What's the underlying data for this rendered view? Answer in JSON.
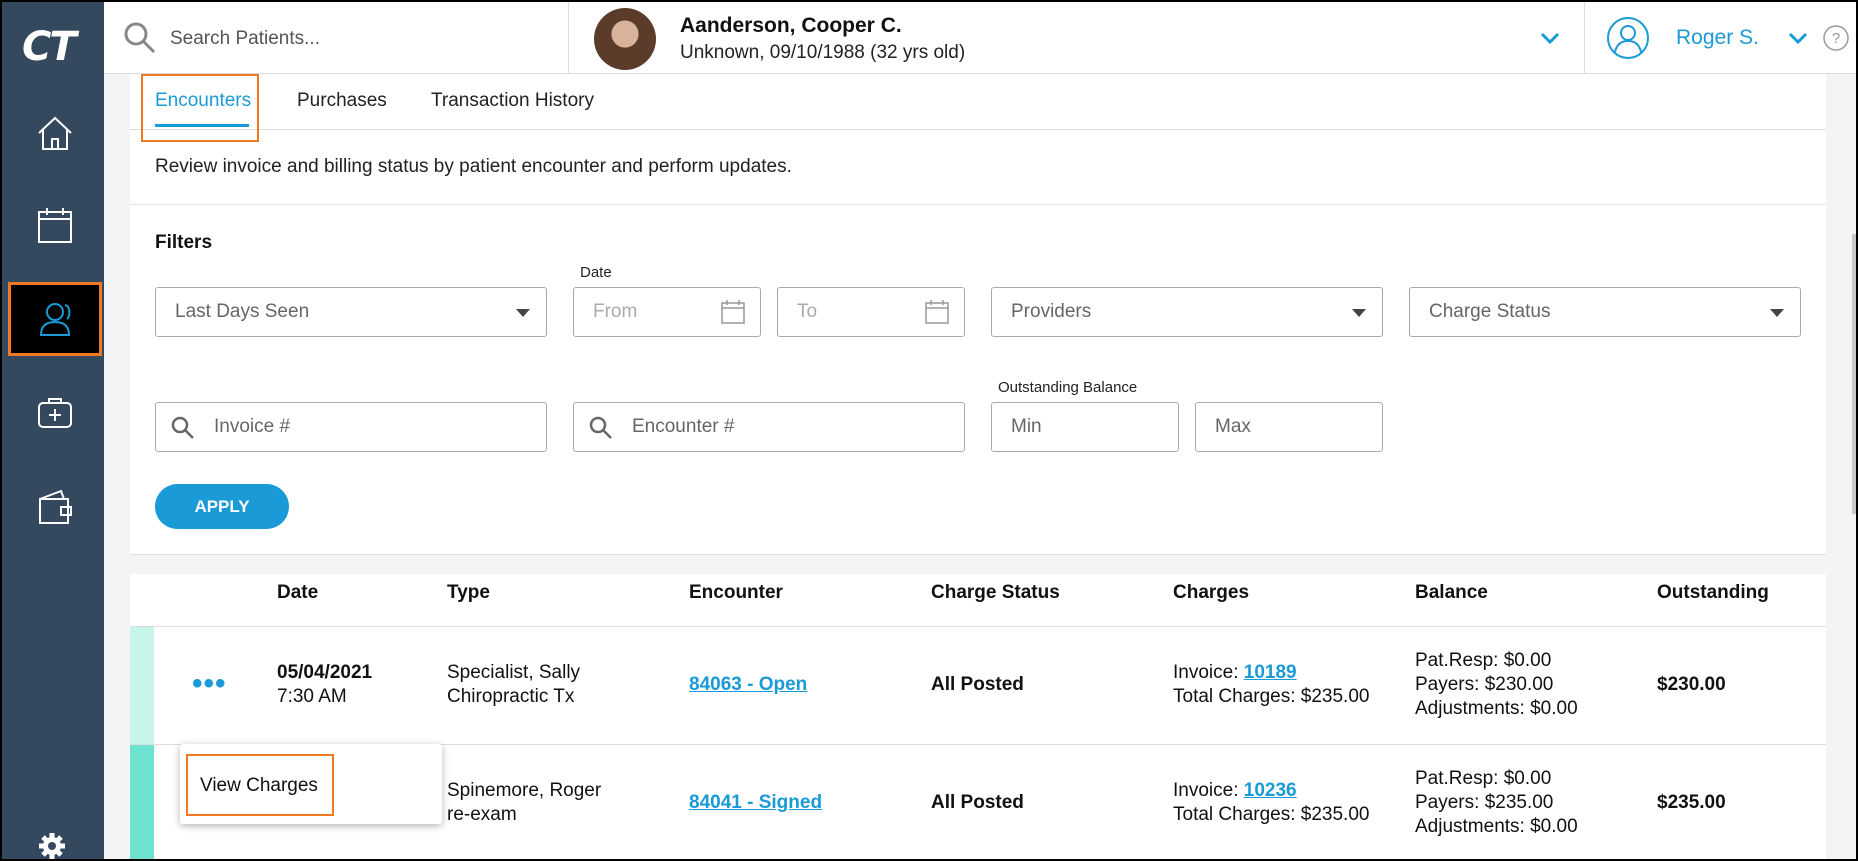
{
  "app": {
    "logo": "CT"
  },
  "sidebar": {
    "items": [
      {
        "name": "home",
        "icon": "home-icon",
        "active": false
      },
      {
        "name": "calendar",
        "icon": "calendar-icon",
        "active": false
      },
      {
        "name": "patients",
        "icon": "users-icon",
        "active": true
      },
      {
        "name": "medical",
        "icon": "medical-kit-icon",
        "active": false
      },
      {
        "name": "wallet",
        "icon": "wallet-icon",
        "active": false
      }
    ],
    "settings_icon": "gear-icon"
  },
  "header": {
    "search_placeholder": "Search Patients...",
    "patient_name": "Aanderson, Cooper C.",
    "patient_info": "Unknown, 09/10/1988 (32 yrs old)",
    "user_name": "Roger S."
  },
  "tabs": [
    {
      "label": "Encounters",
      "active": true
    },
    {
      "label": "Purchases",
      "active": false
    },
    {
      "label": "Transaction History",
      "active": false
    }
  ],
  "description": "Review invoice and billing status by patient encounter and perform updates.",
  "filters": {
    "title": "Filters",
    "last_days_seen": "Last Days Seen",
    "date_label": "Date",
    "from_placeholder": "From",
    "to_placeholder": "To",
    "providers": "Providers",
    "charge_status": "Charge Status",
    "invoice_placeholder": "Invoice #",
    "encounter_placeholder": "Encounter #",
    "outstanding_label": "Outstanding Balance",
    "min_placeholder": "Min",
    "max_placeholder": "Max",
    "apply_label": "APPLY"
  },
  "table": {
    "headers": [
      "Date",
      "Type",
      "Encounter",
      "Charge Status",
      "Charges",
      "Balance",
      "Outstanding"
    ],
    "rows": [
      {
        "date": "05/04/2021",
        "time": "7:30 AM",
        "type_provider": "Specialist, Sally",
        "type_visit": "Chiropractic Tx",
        "encounter": "84063 - Open",
        "charge_status": "All Posted",
        "invoice_label": "Invoice: ",
        "invoice": "10189",
        "total_charges": "Total Charges: $235.00",
        "pat_resp": "Pat.Resp: $0.00",
        "payers": "Payers: $230.00",
        "adjustments": "Adjustments: $0.00",
        "outstanding": "$230.00",
        "stripe_color": "#c8f5ea"
      },
      {
        "date": "",
        "time": "",
        "type_provider": "Spinemore, Roger",
        "type_visit": "re-exam",
        "encounter": "84041 - Signed",
        "charge_status": "All Posted",
        "invoice_label": "Invoice: ",
        "invoice": "10236",
        "total_charges": "Total Charges: $235.00",
        "pat_resp": "Pat.Resp: $0.00",
        "payers": "Payers: $235.00",
        "adjustments": "Adjustments: $0.00",
        "outstanding": "$235.00",
        "stripe_color": "#6de3cf"
      }
    ]
  },
  "popup": {
    "view_charges": "View Charges"
  },
  "colors": {
    "accent": "#1a9ad6",
    "sidebar": "#34495e",
    "highlight": "#f07a23"
  }
}
